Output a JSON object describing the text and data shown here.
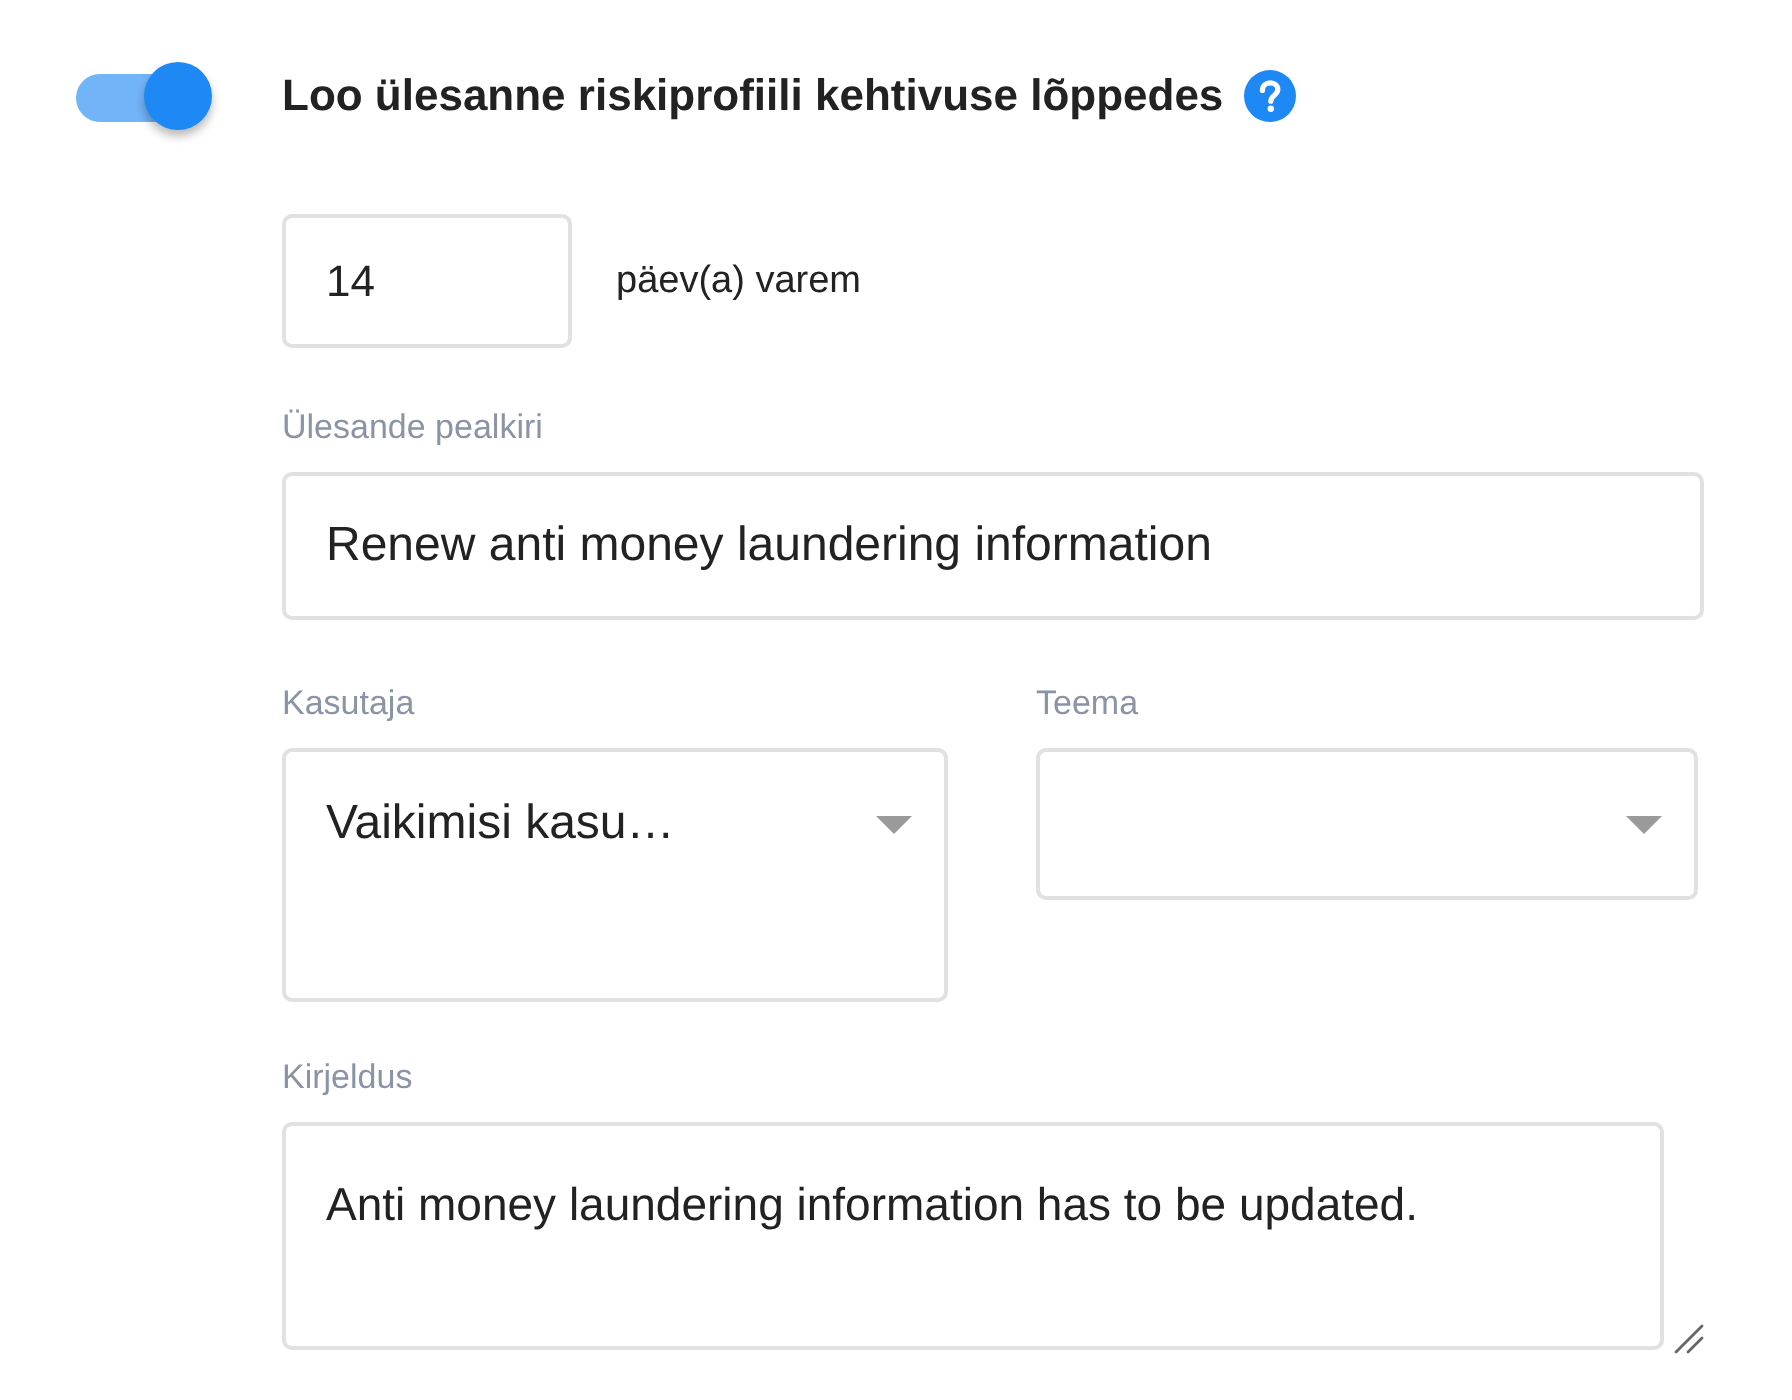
{
  "toggle": {
    "on": true
  },
  "title": "Loo ülesanne riskiprofiili kehtivuse lõppedes",
  "days": {
    "value": "14",
    "suffix": "päev(a) varem"
  },
  "task_title": {
    "label": "Ülesande pealkiri",
    "value": "Renew anti money laundering information"
  },
  "user": {
    "label": "Kasutaja",
    "value": "Vaikimisi kasu…"
  },
  "topic": {
    "label": "Teema"
  },
  "description": {
    "label": "Kirjeldus",
    "value": "Anti money laundering information has to be updated."
  }
}
